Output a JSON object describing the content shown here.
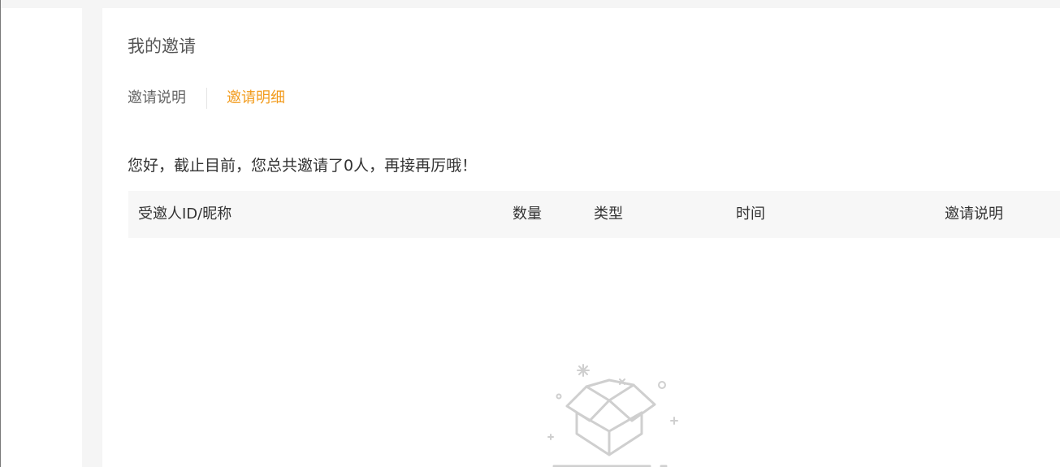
{
  "page": {
    "title": "我的邀请"
  },
  "tabs": [
    {
      "label": "邀请说明",
      "active": false
    },
    {
      "label": "邀请明细",
      "active": true
    }
  ],
  "summary": "您好，截止目前，您总共邀请了0人，再接再厉哦！",
  "table": {
    "columns": [
      "受邀人ID/昵称",
      "数量",
      "类型",
      "时间",
      "邀请说明"
    ],
    "rows": []
  },
  "empty_state": {
    "icon": "empty-box-icon"
  },
  "colors": {
    "accent": "#f29c1f",
    "background": "#f5f5f5",
    "panel": "#ffffff",
    "table_header": "#f7f7f7"
  }
}
